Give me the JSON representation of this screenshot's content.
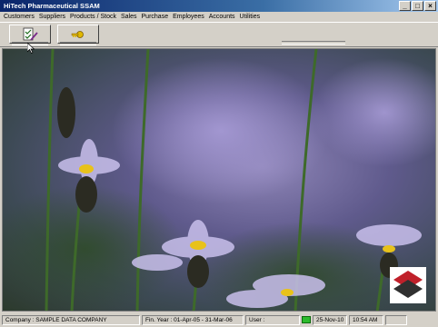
{
  "window": {
    "title": "HiTech Pharmaceutical SSAM"
  },
  "menu": [
    "Customers",
    "Suppliers",
    "Products / Stock",
    "Sales",
    "Purchase",
    "Employees",
    "Accounts",
    "Utilities"
  ],
  "toolbar": {
    "buttons": [
      {
        "icon": "checklist-pen-icon"
      },
      {
        "icon": "key-icon"
      }
    ]
  },
  "status": {
    "company": "Company : SAMPLE DATA COMPANY",
    "fin_year": "Fin. Year : 01-Apr-05 - 31-Mar-06",
    "user": "User :",
    "date": "25-Nov-10",
    "time": "10:54 AM"
  },
  "colors": {
    "title_start": "#0a246a",
    "title_end": "#a6caf0",
    "status_led": "#2dbb2d",
    "logo_red": "#c0202a"
  }
}
